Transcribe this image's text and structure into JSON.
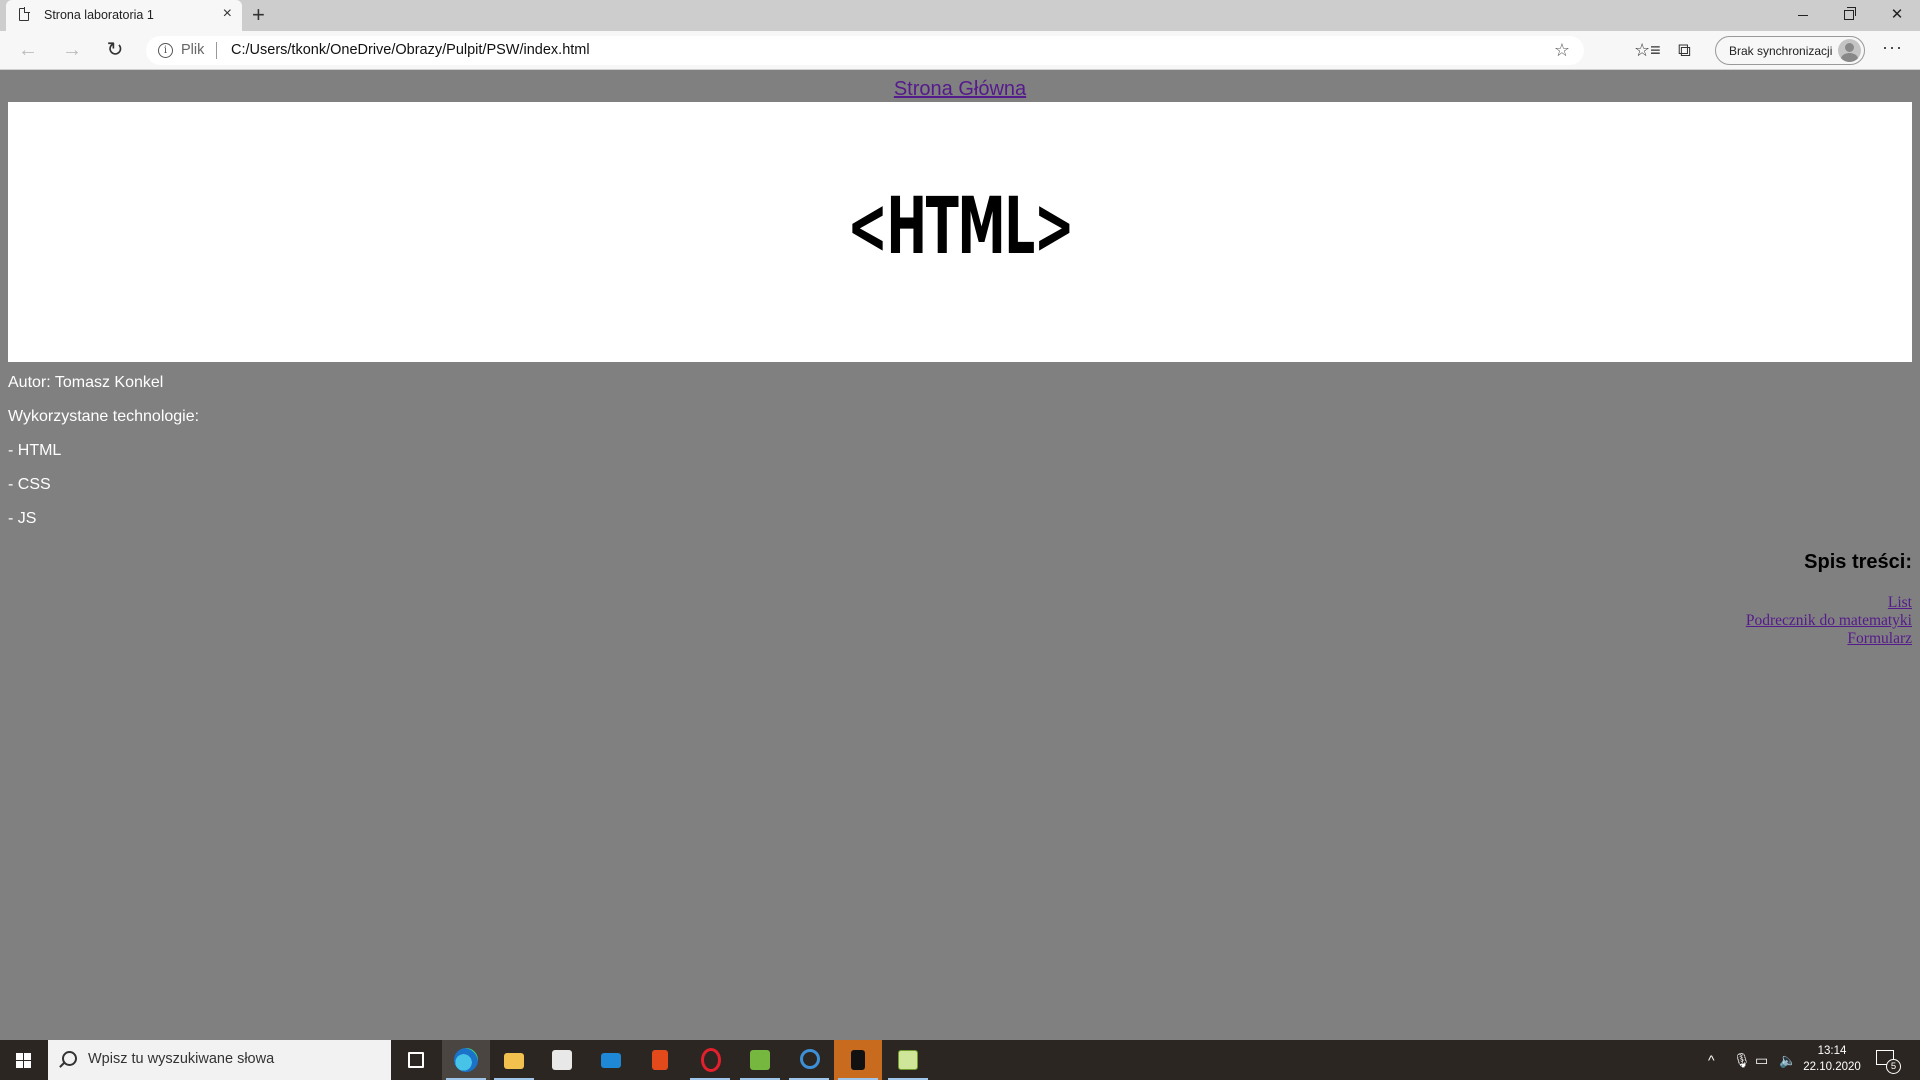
{
  "browser": {
    "tab_title": "Strona laboratoria 1",
    "tab_close": "×",
    "new_tab": "+",
    "address_scheme": "Plik",
    "address_url": "C:/Users/tkonk/OneDrive/Obrazy/Pulpit/PSW/index.html",
    "sync_label": "Brak synchronizacji",
    "more_label": "···"
  },
  "page": {
    "home_link": "Strona Główna",
    "logo_text": "<HTML>",
    "info_lines": {
      "author": "Autor: Tomasz Konkel",
      "tech_heading": "Wykorzystane technologie:",
      "tech_1": "- HTML",
      "tech_2": "- CSS",
      "tech_3": "- JS"
    },
    "toc": {
      "title": "Spis treści:",
      "links": [
        "List",
        "Podrecznik do matematyki",
        "Formularz"
      ]
    },
    "colors": {
      "background": "#808080",
      "link": "#551a8b",
      "banner": "#ffffff"
    }
  },
  "taskbar": {
    "search_placeholder": "Wpisz tu wyszukiwane słowa",
    "time": "13:14",
    "date": "22.10.2020",
    "notification_count": "5",
    "apps": [
      "task-view-icon",
      "edge-icon",
      "file-explorer-icon",
      "store-icon",
      "mail-icon",
      "office-icon",
      "opera-icon",
      "android-studio-icon",
      "app-circle-icon",
      "league-icon",
      "notepad-icon"
    ]
  }
}
